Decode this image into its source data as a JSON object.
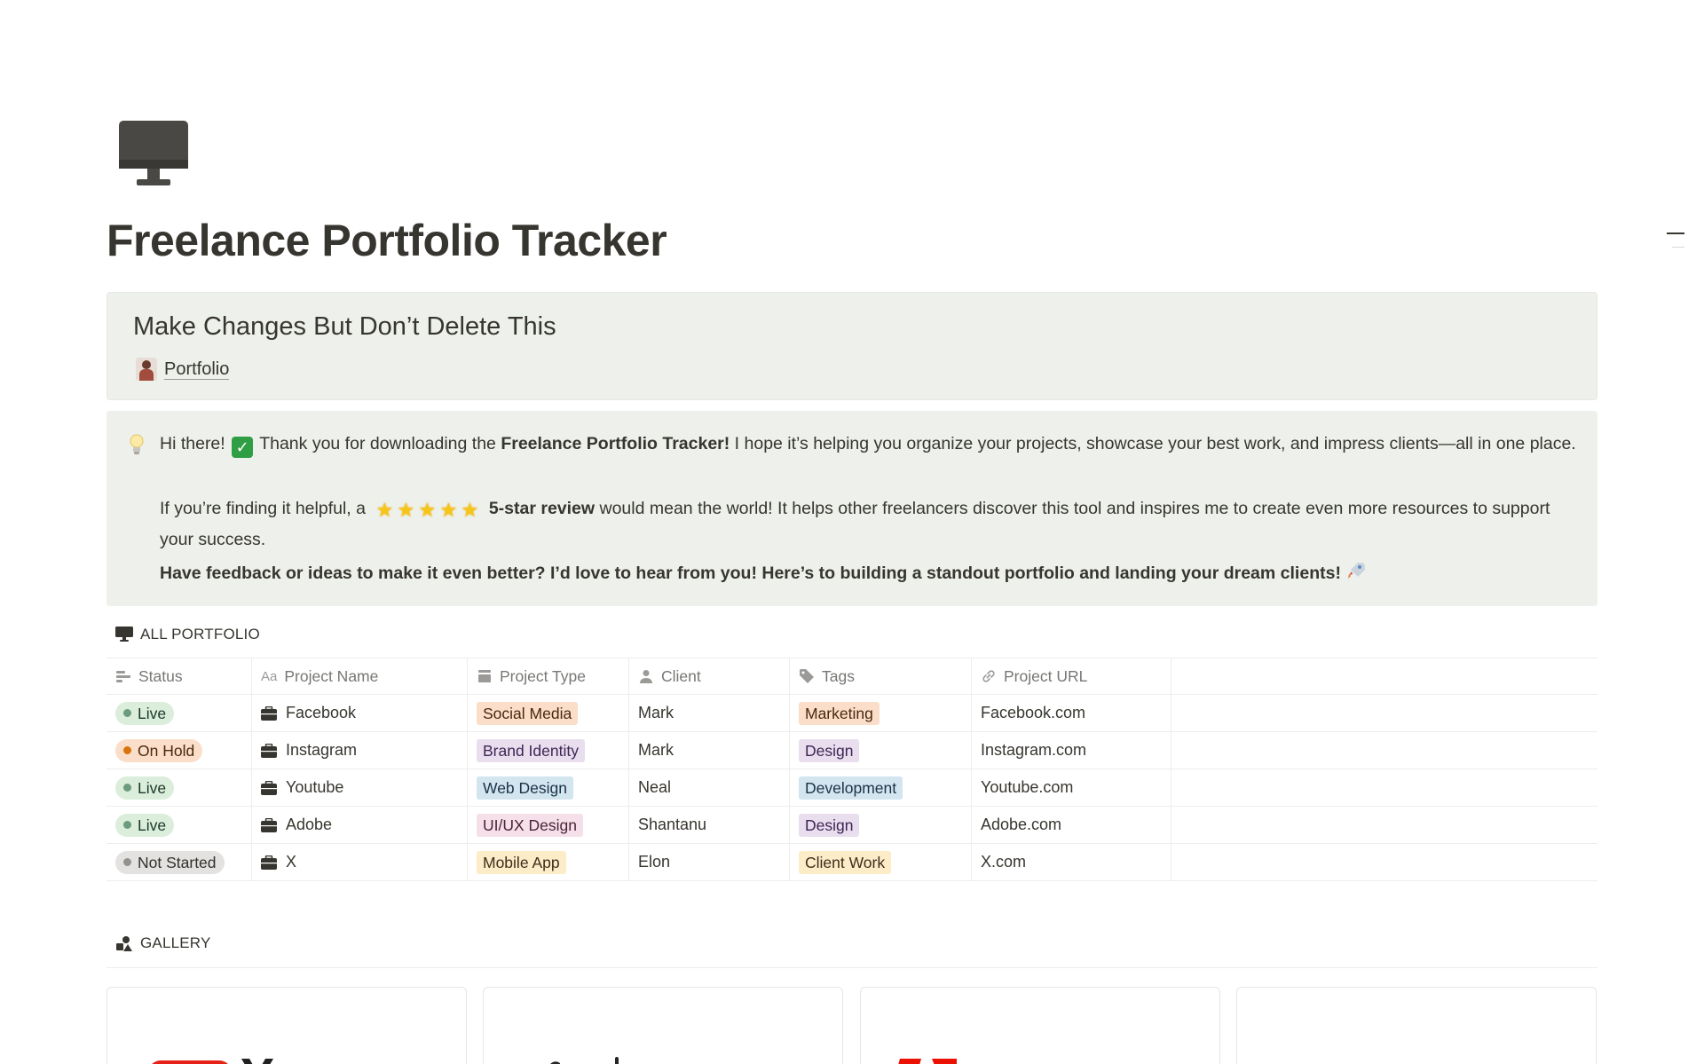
{
  "page": {
    "title": "Freelance Portfolio Tracker",
    "icon": "desktop-computer-icon"
  },
  "callout_top": {
    "heading": "Make Changes But Don’t Delete This",
    "link_label": "Portfolio"
  },
  "callout_info": {
    "p1_a": "Hi there!",
    "p1_b": "Thank you for downloading the",
    "p1_bold": "Freelance Portfolio Tracker!",
    "p1_c": "I hope it’s helping you organize your projects, showcase your best work, and impress clients—all in one place.",
    "p2_a": "If you’re finding it helpful, a",
    "p2_bold": "5-star review",
    "p2_b": "would mean the world! It helps other freelancers discover this tool and inspires me to create even more resources to support your success.",
    "p3_bold": "Have feedback or ideas to make it even better? I’d love to hear from you! Here’s to building a standout portfolio and landing your dream clients!"
  },
  "portfolio_section": {
    "title": "ALL PORTFOLIO",
    "columns": [
      "Status",
      "Project Name",
      "Project Type",
      "Client",
      "Tags",
      "Project URL"
    ],
    "rows": [
      {
        "status": "Live",
        "name": "Facebook",
        "type": "Social Media",
        "client": "Mark",
        "tag": "Marketing",
        "url": "Facebook.com"
      },
      {
        "status": "On Hold",
        "name": "Instagram",
        "type": "Brand Identity",
        "client": "Mark",
        "tag": "Design",
        "url": "Instagram.com"
      },
      {
        "status": "Live",
        "name": "Youtube",
        "type": "Web Design",
        "client": "Neal",
        "tag": "Development",
        "url": "Youtube.com"
      },
      {
        "status": "Live",
        "name": "Adobe",
        "type": "UI/UX Design",
        "client": "Shantanu",
        "tag": "Design",
        "url": "Adobe.com"
      },
      {
        "status": "Not Started",
        "name": "X",
        "type": "Mobile App",
        "client": "Elon",
        "tag": "Client Work",
        "url": "X.com"
      }
    ]
  },
  "gallery_section": {
    "title": "GALLERY"
  },
  "colors": {
    "callout_bg": "#edf0eb",
    "status_live_bg": "#dbeddb",
    "status_live_dot": "#6c9b7d",
    "status_onhold_bg": "#fadec9",
    "status_onhold_dot": "#d9730d",
    "status_notstarted_bg": "#e3e2e0",
    "status_notstarted_dot": "#91918e"
  }
}
